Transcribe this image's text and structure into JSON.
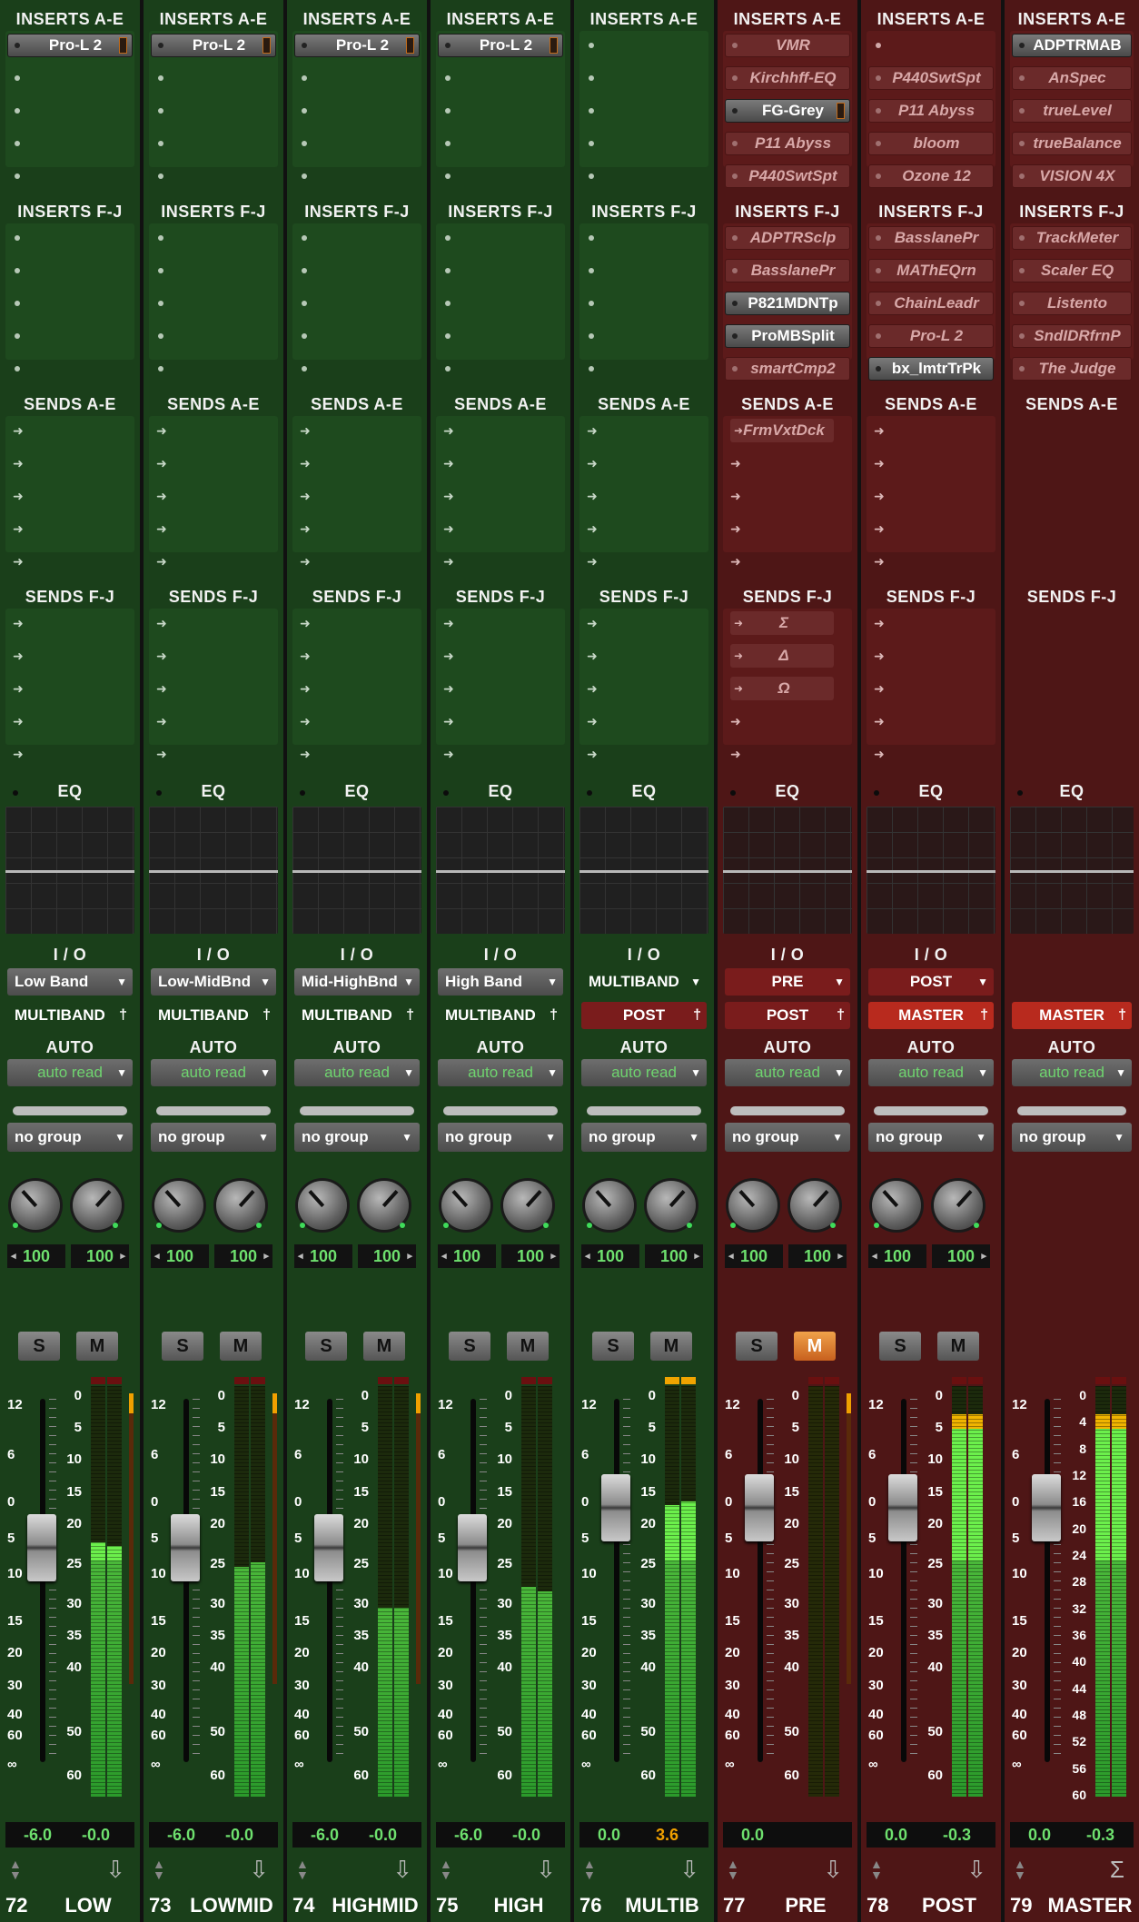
{
  "section_labels": {
    "inserts_ae": "INSERTS A-E",
    "inserts_fj": "INSERTS F-J",
    "sends_ae": "SENDS A-E",
    "sends_fj": "SENDS F-J",
    "eq": "EQ",
    "io": "I / O",
    "auto": "AUTO"
  },
  "channels": [
    {
      "number": "72",
      "name": "LOW",
      "color": "green",
      "inserts_ae": [
        {
          "name": "Pro-L 2",
          "state": "active",
          "indicator": true
        },
        null,
        null,
        null,
        null
      ],
      "inserts_fj": [
        null,
        null,
        null,
        null,
        null
      ],
      "sends_ae": [
        null,
        null,
        null,
        null,
        null
      ],
      "sends_fj": [
        null,
        null,
        null,
        null,
        null
      ],
      "input": "Low Band",
      "output": "MULTIBAND",
      "output_style": "plain",
      "automation": "auto read",
      "group": "no group",
      "pan_left": "100",
      "pan_right": "100",
      "solo": "S",
      "mute": "M",
      "mute_on": false,
      "fader_db": -6.0,
      "meter_left": 0.62,
      "meter_right": 0.61,
      "sidebar_meter": true,
      "out_left": "-6.0",
      "out_right": "-0.0",
      "out_right_color": "green"
    },
    {
      "number": "73",
      "name": "LOWMID",
      "color": "green",
      "inserts_ae": [
        {
          "name": "Pro-L 2",
          "state": "active",
          "indicator": true
        },
        null,
        null,
        null,
        null
      ],
      "inserts_fj": [
        null,
        null,
        null,
        null,
        null
      ],
      "sends_ae": [
        null,
        null,
        null,
        null,
        null
      ],
      "sends_fj": [
        null,
        null,
        null,
        null,
        null
      ],
      "input": "Low-MidBnd",
      "output": "MULTIBAND",
      "output_style": "plain",
      "automation": "auto read",
      "group": "no group",
      "pan_left": "100",
      "pan_right": "100",
      "solo": "S",
      "mute": "M",
      "mute_on": false,
      "fader_db": -6.0,
      "meter_left": 0.56,
      "meter_right": 0.57,
      "sidebar_meter": true,
      "out_left": "-6.0",
      "out_right": "-0.0",
      "out_right_color": "green"
    },
    {
      "number": "74",
      "name": "HIGHMID",
      "color": "green",
      "inserts_ae": [
        {
          "name": "Pro-L 2",
          "state": "active",
          "indicator": true
        },
        null,
        null,
        null,
        null
      ],
      "inserts_fj": [
        null,
        null,
        null,
        null,
        null
      ],
      "sends_ae": [
        null,
        null,
        null,
        null,
        null
      ],
      "sends_fj": [
        null,
        null,
        null,
        null,
        null
      ],
      "input": "Mid-HighBnd",
      "output": "MULTIBAND",
      "output_style": "plain",
      "automation": "auto read",
      "group": "no group",
      "pan_left": "100",
      "pan_right": "100",
      "solo": "S",
      "mute": "M",
      "mute_on": false,
      "fader_db": -6.0,
      "meter_left": 0.46,
      "meter_right": 0.46,
      "sidebar_meter": true,
      "out_left": "-6.0",
      "out_right": "-0.0",
      "out_right_color": "green"
    },
    {
      "number": "75",
      "name": "HIGH",
      "color": "green",
      "inserts_ae": [
        {
          "name": "Pro-L 2",
          "state": "active",
          "indicator": true
        },
        null,
        null,
        null,
        null
      ],
      "inserts_fj": [
        null,
        null,
        null,
        null,
        null
      ],
      "sends_ae": [
        null,
        null,
        null,
        null,
        null
      ],
      "sends_fj": [
        null,
        null,
        null,
        null,
        null
      ],
      "input": "High Band",
      "output": "MULTIBAND",
      "output_style": "plain",
      "automation": "auto read",
      "group": "no group",
      "pan_left": "100",
      "pan_right": "100",
      "solo": "S",
      "mute": "M",
      "mute_on": false,
      "fader_db": -6.0,
      "meter_left": 0.51,
      "meter_right": 0.5,
      "sidebar_meter": false,
      "out_left": "-6.0",
      "out_right": "-0.0",
      "out_right_color": "green"
    },
    {
      "number": "76",
      "name": "MULTIB",
      "color": "green",
      "inserts_ae": [
        null,
        null,
        null,
        null,
        null
      ],
      "inserts_fj": [
        null,
        null,
        null,
        null,
        null
      ],
      "sends_ae": [
        null,
        null,
        null,
        null,
        null
      ],
      "sends_fj": [
        null,
        null,
        null,
        null,
        null
      ],
      "input": "MULTIBAND",
      "output": "POST",
      "output_style": "darkred",
      "automation": "auto read",
      "group": "no group",
      "pan_left": "100",
      "pan_right": "100",
      "solo": "S",
      "mute": "M",
      "mute_on": false,
      "fader_db": 0.0,
      "meter_left": 0.71,
      "meter_right": 0.72,
      "sidebar_meter": false,
      "clip_yellow": true,
      "out_left": "0.0",
      "out_right": "3.6",
      "out_right_color": "orange"
    },
    {
      "number": "77",
      "name": "PRE",
      "color": "red",
      "inserts_ae": [
        {
          "name": "VMR",
          "state": "inactive"
        },
        {
          "name": "Kirchhff-EQ",
          "state": "inactive"
        },
        {
          "name": "FG-Grey",
          "state": "active",
          "indicator": true
        },
        {
          "name": "P11 Abyss",
          "state": "inactive"
        },
        {
          "name": "P440SwtSpt",
          "state": "inactive"
        }
      ],
      "inserts_fj": [
        {
          "name": "ADPTRSclp",
          "state": "inactive"
        },
        {
          "name": "BasslanePr",
          "state": "inactive"
        },
        {
          "name": "P821MDNTp",
          "state": "active"
        },
        {
          "name": "ProMBSplit",
          "state": "active"
        },
        {
          "name": "smartCmp2",
          "state": "inactive"
        }
      ],
      "sends_ae": [
        {
          "name": "FrmVxtDck"
        },
        null,
        null,
        null,
        null
      ],
      "sends_fj": [
        {
          "name": "Σ"
        },
        {
          "name": "Δ"
        },
        {
          "name": "Ω"
        },
        null,
        null
      ],
      "input": "PRE",
      "output": "POST",
      "output_style": "darkred",
      "input_style": "darkred",
      "automation": "auto read",
      "group": "no group",
      "pan_left": "100",
      "pan_right": "100",
      "solo": "S",
      "mute": "M",
      "mute_on": true,
      "fader_db": 0.0,
      "meter_left": 0.0,
      "meter_right": 0.0,
      "sidebar_meter": true,
      "dark_meter": true,
      "out_left": "0.0",
      "out_right": "",
      "out_right_color": "green"
    },
    {
      "number": "78",
      "name": "POST",
      "color": "red",
      "inserts_ae": [
        null,
        {
          "name": "P440SwtSpt",
          "state": "inactive"
        },
        {
          "name": "P11 Abyss",
          "state": "inactive"
        },
        {
          "name": "bloom",
          "state": "inactive"
        },
        {
          "name": "Ozone 12",
          "state": "inactive"
        }
      ],
      "inserts_fj": [
        {
          "name": "BasslanePr",
          "state": "inactive"
        },
        {
          "name": "MAThEQrn",
          "state": "inactive"
        },
        {
          "name": "ChainLeadr",
          "state": "inactive"
        },
        {
          "name": "Pro-L 2",
          "state": "inactive"
        },
        {
          "name": "bx_lmtrTrPk",
          "state": "active"
        }
      ],
      "sends_ae": [
        null,
        null,
        null,
        null,
        null
      ],
      "sends_fj": [
        null,
        null,
        null,
        null,
        null
      ],
      "input": "POST",
      "output": "MASTER",
      "output_style": "bright",
      "input_style": "darkred",
      "automation": "auto read",
      "group": "no group",
      "pan_left": "100",
      "pan_right": "100",
      "solo": "S",
      "mute": "M",
      "mute_on": false,
      "fader_db": 0.0,
      "meter_left": 0.9,
      "meter_right": 0.9,
      "sidebar_meter": false,
      "yellow_top": true,
      "out_left": "0.0",
      "out_right": "-0.3",
      "out_right_color": "green"
    },
    {
      "number": "79",
      "name": "MASTER",
      "color": "red",
      "inserts_ae": [
        {
          "name": "ADPTRMAB",
          "state": "active"
        },
        {
          "name": "AnSpec",
          "state": "inactive"
        },
        {
          "name": "trueLevel",
          "state": "inactive"
        },
        {
          "name": "trueBalance",
          "state": "inactive"
        },
        {
          "name": "VISION 4X",
          "state": "inactive"
        }
      ],
      "inserts_fj": [
        {
          "name": "TrackMeter",
          "state": "inactive"
        },
        {
          "name": "Scaler EQ",
          "state": "inactive"
        },
        {
          "name": "Listento",
          "state": "inactive"
        },
        {
          "name": "SndIDRfrnP",
          "state": "inactive"
        },
        {
          "name": "The Judge",
          "state": "inactive"
        }
      ],
      "sends_ae": [],
      "sends_fj": [],
      "master": true,
      "input": "",
      "output": "MASTER",
      "output_style": "bright",
      "automation": "auto read",
      "group": "no group",
      "pan_left": "",
      "pan_right": "",
      "solo": "",
      "mute": "",
      "mute_on": false,
      "fader_db": 0.0,
      "meter_left": 0.9,
      "meter_right": 0.9,
      "sidebar_meter": false,
      "yellow_top": true,
      "out_left": "0.0",
      "out_right": "-0.3",
      "out_right_color": "green"
    }
  ],
  "fader_scale": [
    "12",
    "6",
    "0",
    "5",
    "10",
    "15",
    "20",
    "30",
    "40",
    "60",
    "∞"
  ],
  "meter_scale": [
    "0",
    "5",
    "10",
    "15",
    "20",
    "25",
    "30",
    "35",
    "40",
    "50",
    "60"
  ],
  "master_meter_scale": [
    "0",
    "4",
    "8",
    "12",
    "16",
    "20",
    "24",
    "28",
    "32",
    "36",
    "40",
    "44",
    "48",
    "52",
    "56",
    "60"
  ],
  "colors": {
    "green_strip": "#1a3f1a",
    "red_strip": "#4e1616",
    "meter_green": "#6cf04c",
    "value_green": "#6ee06e",
    "value_orange": "#f0a000"
  }
}
